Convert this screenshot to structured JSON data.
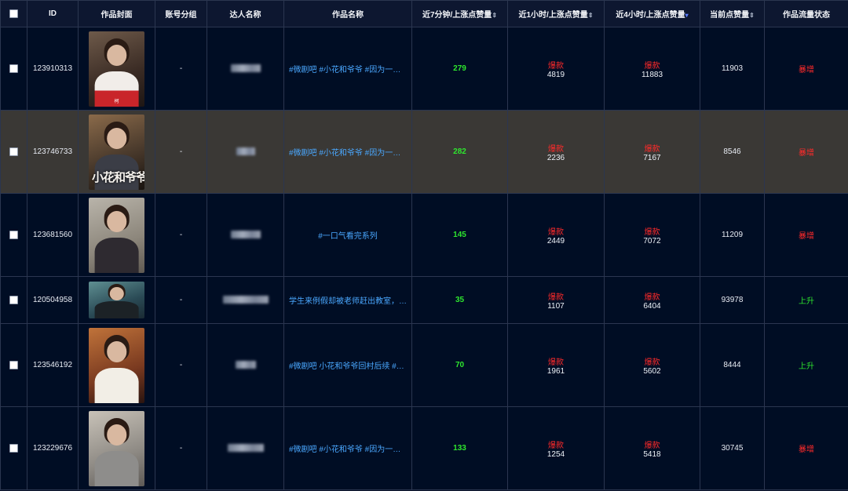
{
  "header": {
    "id": "ID",
    "cover": "作品封面",
    "group": "账号分组",
    "creator": "达人名称",
    "title": "作品名称",
    "likes_7min": "近7分钟/上涨点赞量",
    "likes_1h": "近1小时/上涨点赞量",
    "likes_4h": "近4小时/上涨点赞量",
    "likes_current": "当前点赞量",
    "status": "作品流量状态",
    "sort_icon": "⇕",
    "sort_down_icon": "▾"
  },
  "rows": [
    {
      "id": "123910313",
      "group": "-",
      "title": "#微剧吧 #小花和爷爷 #因为一个片…",
      "likes_7min": "279",
      "hot_1h": "爆款",
      "likes_1h": "4819",
      "hot_4h": "爆款",
      "likes_4h": "11883",
      "likes_current": "11903",
      "status": "暴增",
      "status_color": "#ff2a2a",
      "cover_caption": "柯"
    },
    {
      "id": "123746733",
      "group": "-",
      "title": "#微剧吧 #小花和爷爷 #因为一个片…",
      "likes_7min": "282",
      "hot_1h": "爆款",
      "likes_1h": "2236",
      "hot_4h": "爆款",
      "likes_4h": "7167",
      "likes_current": "8546",
      "status": "暴增",
      "status_color": "#ff2a2a",
      "cover_caption": "小花和爷爷"
    },
    {
      "id": "123681560",
      "group": "-",
      "title": "#一口气看完系列",
      "likes_7min": "145",
      "hot_1h": "爆款",
      "likes_1h": "2449",
      "hot_4h": "爆款",
      "likes_4h": "7072",
      "likes_current": "11209",
      "status": "暴增",
      "status_color": "#ff2a2a"
    },
    {
      "id": "120504958",
      "group": "-",
      "title": "学生来例假却被老师赶出教室，还…",
      "likes_7min": "35",
      "hot_1h": "爆款",
      "likes_1h": "1107",
      "hot_4h": "爆款",
      "likes_4h": "6404",
      "likes_current": "93978",
      "status": "上升",
      "status_color": "#2ee62e"
    },
    {
      "id": "123546192",
      "group": "-",
      "title": "#微剧吧 小花和爷爷回村后续 #小…",
      "likes_7min": "70",
      "hot_1h": "爆款",
      "likes_1h": "1961",
      "hot_4h": "爆款",
      "likes_4h": "5602",
      "likes_current": "8444",
      "status": "上升",
      "status_color": "#2ee62e"
    },
    {
      "id": "123229676",
      "group": "-",
      "title": "#微剧吧 #小花和爷爷 #因为一个片…",
      "likes_7min": "133",
      "hot_1h": "爆款",
      "likes_1h": "1254",
      "hot_4h": "爆款",
      "likes_4h": "5418",
      "likes_current": "30745",
      "status": "暴增",
      "status_color": "#ff2a2a"
    }
  ]
}
